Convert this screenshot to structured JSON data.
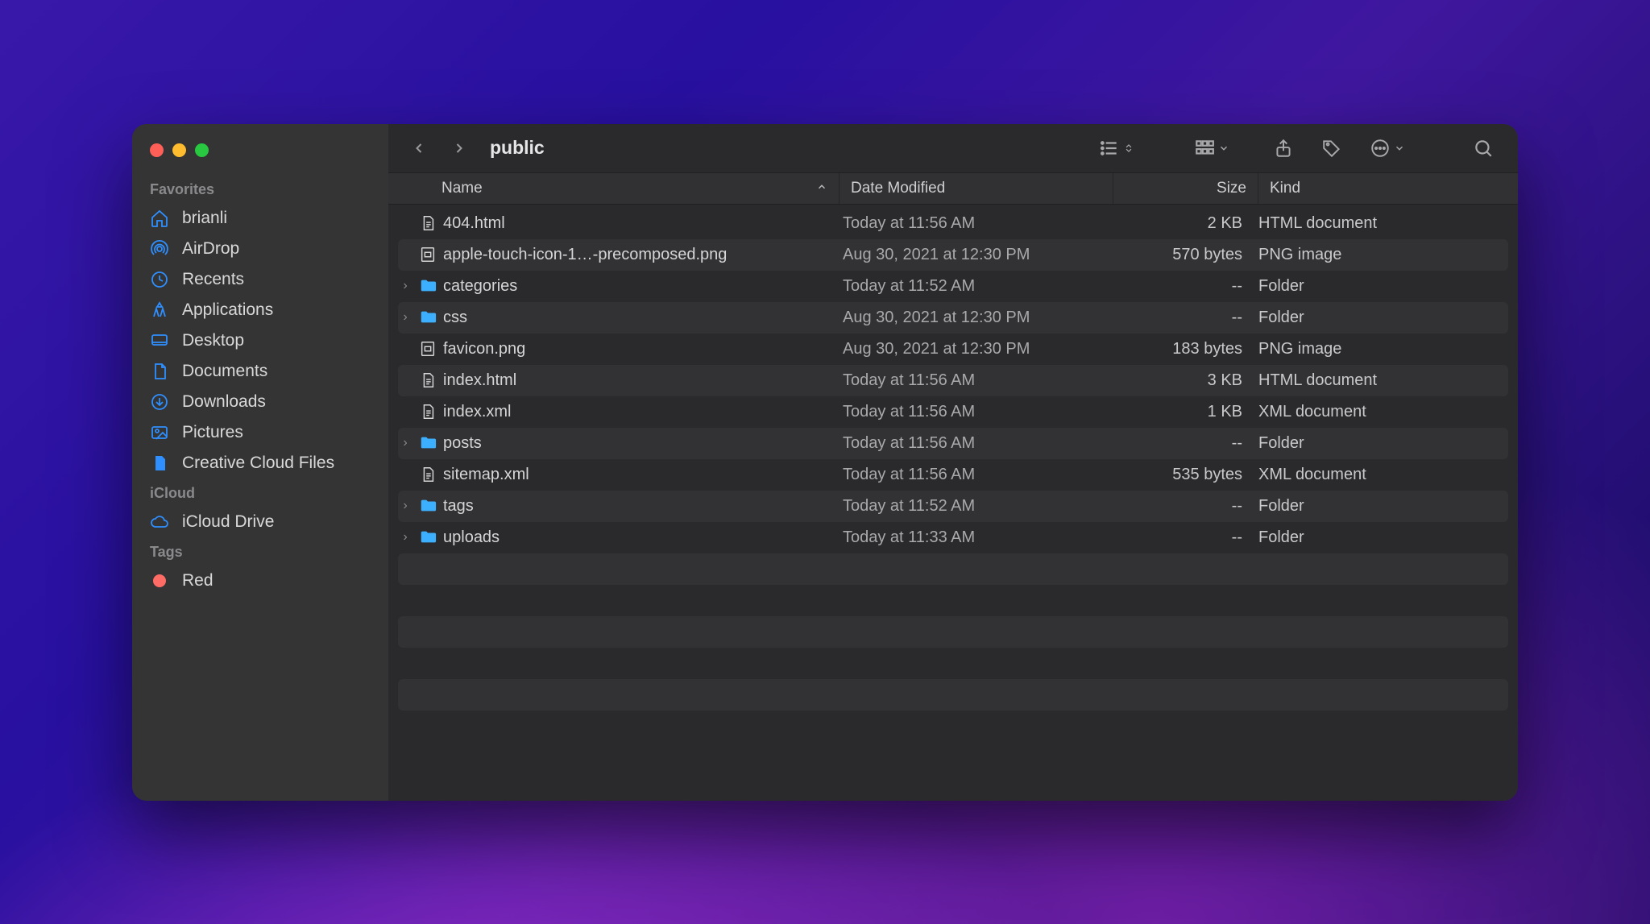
{
  "window": {
    "title": "public"
  },
  "sidebar": {
    "sections": [
      {
        "title": "Favorites",
        "items": [
          {
            "label": "brianli",
            "icon": "home"
          },
          {
            "label": "AirDrop",
            "icon": "airdrop"
          },
          {
            "label": "Recents",
            "icon": "clock"
          },
          {
            "label": "Applications",
            "icon": "apps"
          },
          {
            "label": "Desktop",
            "icon": "desktop"
          },
          {
            "label": "Documents",
            "icon": "doc"
          },
          {
            "label": "Downloads",
            "icon": "download"
          },
          {
            "label": "Pictures",
            "icon": "pictures"
          },
          {
            "label": "Creative Cloud Files",
            "icon": "ccfile"
          }
        ]
      },
      {
        "title": "iCloud",
        "items": [
          {
            "label": "iCloud Drive",
            "icon": "cloud"
          }
        ]
      },
      {
        "title": "Tags",
        "items": [
          {
            "label": "Red",
            "icon": "tag-red"
          }
        ]
      }
    ]
  },
  "columns": {
    "name": "Name",
    "date": "Date Modified",
    "size": "Size",
    "kind": "Kind",
    "sort": "name-asc"
  },
  "files": [
    {
      "name": "404.html",
      "date": "Today at 11:56 AM",
      "size": "2 KB",
      "kind": "HTML document",
      "type": "file",
      "expandable": false
    },
    {
      "name": "apple-touch-icon-1…-precomposed.png",
      "date": "Aug 30, 2021 at 12:30 PM",
      "size": "570 bytes",
      "kind": "PNG image",
      "type": "image",
      "expandable": false
    },
    {
      "name": "categories",
      "date": "Today at 11:52 AM",
      "size": "--",
      "kind": "Folder",
      "type": "folder",
      "expandable": true
    },
    {
      "name": "css",
      "date": "Aug 30, 2021 at 12:30 PM",
      "size": "--",
      "kind": "Folder",
      "type": "folder",
      "expandable": true
    },
    {
      "name": "favicon.png",
      "date": "Aug 30, 2021 at 12:30 PM",
      "size": "183 bytes",
      "kind": "PNG image",
      "type": "image",
      "expandable": false
    },
    {
      "name": "index.html",
      "date": "Today at 11:56 AM",
      "size": "3 KB",
      "kind": "HTML document",
      "type": "file",
      "expandable": false
    },
    {
      "name": "index.xml",
      "date": "Today at 11:56 AM",
      "size": "1 KB",
      "kind": "XML document",
      "type": "file",
      "expandable": false
    },
    {
      "name": "posts",
      "date": "Today at 11:56 AM",
      "size": "--",
      "kind": "Folder",
      "type": "folder",
      "expandable": true
    },
    {
      "name": "sitemap.xml",
      "date": "Today at 11:56 AM",
      "size": "535 bytes",
      "kind": "XML document",
      "type": "file",
      "expandable": false
    },
    {
      "name": "tags",
      "date": "Today at 11:52 AM",
      "size": "--",
      "kind": "Folder",
      "type": "folder",
      "expandable": true
    },
    {
      "name": "uploads",
      "date": "Today at 11:33 AM",
      "size": "--",
      "kind": "Folder",
      "type": "folder",
      "expandable": true
    }
  ]
}
